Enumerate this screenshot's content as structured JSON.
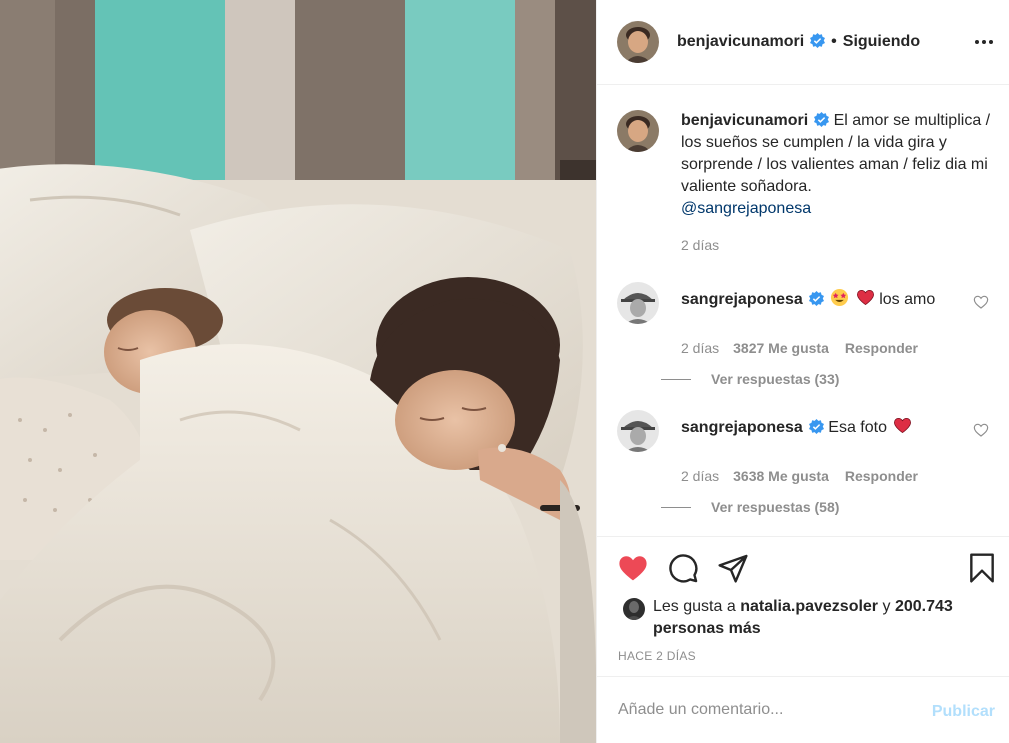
{
  "post": {
    "author": "benjavicunamori",
    "follow_state": "Siguiendo",
    "separator": "•",
    "caption_text": "El amor se multiplica / los sueños se cumplen / la vida gira y sorprende / los valientes aman / feliz dia mi valiente soñadora.",
    "caption_mention": "@sangrejaponesa",
    "caption_time": "2 días"
  },
  "comments": [
    {
      "user": "sangrejaponesa",
      "text": "los amo",
      "emojis": [
        "star-struck-emoji",
        "red-heart-emoji"
      ],
      "time": "2 días",
      "likes": "3827 Me gusta",
      "reply_label": "Responder",
      "view_replies": "Ver respuestas (33)"
    },
    {
      "user": "sangrejaponesa",
      "text": "Esa foto",
      "emojis": [
        "red-heart-emoji"
      ],
      "time": "2 días",
      "likes": "3638 Me gusta",
      "reply_label": "Responder",
      "view_replies": "Ver respuestas (58)"
    }
  ],
  "actions": {
    "liked": true,
    "icons": [
      "heart-icon",
      "comment-icon",
      "share-icon",
      "bookmark-icon"
    ]
  },
  "likes": {
    "prefix": "Les gusta a",
    "liker": "natalia.pavezsoler",
    "connector": "y",
    "others": "200.743 personas más"
  },
  "post_time": "HACE 2 DÍAS",
  "comment_box": {
    "placeholder": "Añade un comentario...",
    "publish_label": "Publicar"
  },
  "colors": {
    "like_red": "#ed4956",
    "verified_blue": "#3897f0",
    "mention_blue": "#00376b",
    "publish_disabled": "#b2dffc",
    "secondary_text": "#8e8e8e"
  }
}
